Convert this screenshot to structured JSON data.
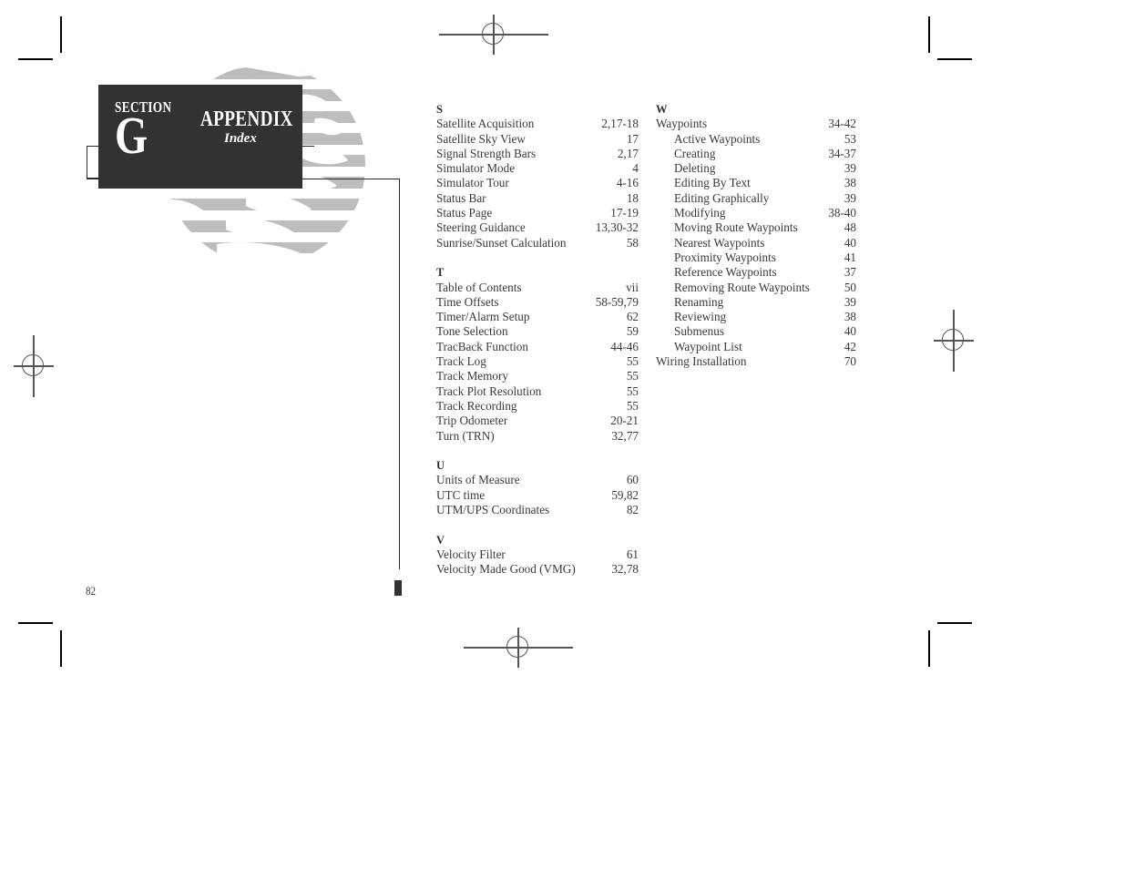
{
  "document": {
    "page_number": "82",
    "header": {
      "section_label": "SECTION",
      "section_letter": "G",
      "title": "APPENDIX",
      "subtitle": "Index"
    },
    "colors": {
      "header_background": "#323232",
      "header_text": "#ffffff",
      "body_text": "#3a3a3a",
      "watermark": "#bcbcbc",
      "crop_mark": "#000000",
      "registration_mark": "#555555"
    }
  },
  "index": {
    "columns": [
      {
        "id": "left",
        "groups": [
          {
            "letter": "S",
            "entries": [
              {
                "name": "Satellite Acquisition",
                "pages": "2,17-18",
                "level": 0
              },
              {
                "name": "Satellite Sky View",
                "pages": "17",
                "level": 0
              },
              {
                "name": "Signal Strength Bars",
                "pages": "2,17",
                "level": 0
              },
              {
                "name": "Simulator Mode",
                "pages": "4",
                "level": 0
              },
              {
                "name": "Simulator Tour",
                "pages": "4-16",
                "level": 0
              },
              {
                "name": "Status Bar",
                "pages": "18",
                "level": 0
              },
              {
                "name": "Status Page",
                "pages": "17-19",
                "level": 0
              },
              {
                "name": "Steering Guidance",
                "pages": "13,30-32",
                "level": 0
              },
              {
                "name": "Sunrise/Sunset Calculation",
                "pages": "58",
                "level": 0
              }
            ]
          },
          {
            "letter": "T",
            "entries": [
              {
                "name": "Table of Contents",
                "pages": "vii",
                "level": 0
              },
              {
                "name": "Time Offsets",
                "pages": "58-59,79",
                "level": 0
              },
              {
                "name": "Timer/Alarm Setup",
                "pages": "62",
                "level": 0
              },
              {
                "name": "Tone Selection",
                "pages": "59",
                "level": 0
              },
              {
                "name": "TracBack Function",
                "pages": "44-46",
                "level": 0
              },
              {
                "name": "Track Log",
                "pages": "55",
                "level": 0
              },
              {
                "name": "Track Memory",
                "pages": "55",
                "level": 0
              },
              {
                "name": "Track Plot Resolution",
                "pages": "55",
                "level": 0
              },
              {
                "name": "Track Recording",
                "pages": "55",
                "level": 0
              },
              {
                "name": "Trip Odometer",
                "pages": "20-21",
                "level": 0
              },
              {
                "name": "Turn (TRN)",
                "pages": "32,77",
                "level": 0
              }
            ]
          },
          {
            "letter": "U",
            "entries": [
              {
                "name": "Units of Measure",
                "pages": "60",
                "level": 0
              },
              {
                "name": "UTC time",
                "pages": "59,82",
                "level": 0
              },
              {
                "name": "UTM/UPS Coordinates",
                "pages": "82",
                "level": 0
              }
            ]
          },
          {
            "letter": "V",
            "entries": [
              {
                "name": "Velocity Filter",
                "pages": "61",
                "level": 0
              },
              {
                "name": "Velocity Made Good (VMG)",
                "pages": "32,78",
                "level": 0
              }
            ]
          }
        ]
      },
      {
        "id": "right",
        "groups": [
          {
            "letter": "W",
            "entries": [
              {
                "name": "Waypoints",
                "pages": "34-42",
                "level": 0
              },
              {
                "name": "Active Waypoints",
                "pages": "53",
                "level": 1
              },
              {
                "name": "Creating",
                "pages": "34-37",
                "level": 1
              },
              {
                "name": "Deleting",
                "pages": "39",
                "level": 1
              },
              {
                "name": "Editing By Text",
                "pages": "38",
                "level": 1
              },
              {
                "name": "Editing Graphically",
                "pages": "39",
                "level": 1
              },
              {
                "name": "Modifying",
                "pages": "38-40",
                "level": 1
              },
              {
                "name": "Moving Route Waypoints",
                "pages": "48",
                "level": 1
              },
              {
                "name": "Nearest Waypoints",
                "pages": "40",
                "level": 1
              },
              {
                "name": "Proximity Waypoints",
                "pages": "41",
                "level": 1
              },
              {
                "name": "Reference Waypoints",
                "pages": "37",
                "level": 1
              },
              {
                "name": "Removing Route Waypoints",
                "pages": "50",
                "level": 1
              },
              {
                "name": "Renaming",
                "pages": "39",
                "level": 1
              },
              {
                "name": "Reviewing",
                "pages": "38",
                "level": 1
              },
              {
                "name": "Submenus",
                "pages": "40",
                "level": 1
              },
              {
                "name": "Waypoint List",
                "pages": "42",
                "level": 1
              },
              {
                "name": "Wiring Installation",
                "pages": "70",
                "level": 0
              }
            ]
          }
        ]
      }
    ]
  }
}
